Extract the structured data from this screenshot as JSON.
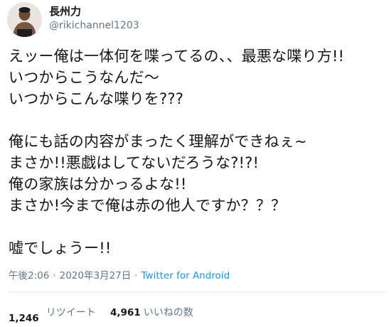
{
  "user": {
    "display_name": "長州力",
    "handle": "@rikichannel1203",
    "avatar_icon": "profile-photo-icon"
  },
  "tweet": {
    "lines": [
      "えッー俺は一体何を喋ってるの、、最悪な喋り方!!",
      "いつからこうなんだ〜",
      "いつからこんな喋りを???",
      "",
      "俺にも話の内容がまったく理解ができねぇ~",
      "まさか!!悪戯はしてないだろうな?!?!",
      "俺の家族は分かっるよな!!",
      "まさか!今まで俺は赤の他人ですか？？？",
      "",
      "嘘でしょうー!!"
    ]
  },
  "meta": {
    "time": "午後2:06",
    "separator": "·",
    "date": "2020年3月27日",
    "source": "Twitter for Android"
  },
  "stats": {
    "retweets_count": "1,246",
    "retweets_label": "リツイート",
    "likes_count": "4,961",
    "likes_label": "いいねの数"
  },
  "colors": {
    "text": "#14171a",
    "secondary": "#657786",
    "link": "#1b95e0",
    "divider": "#e6ecf0"
  }
}
